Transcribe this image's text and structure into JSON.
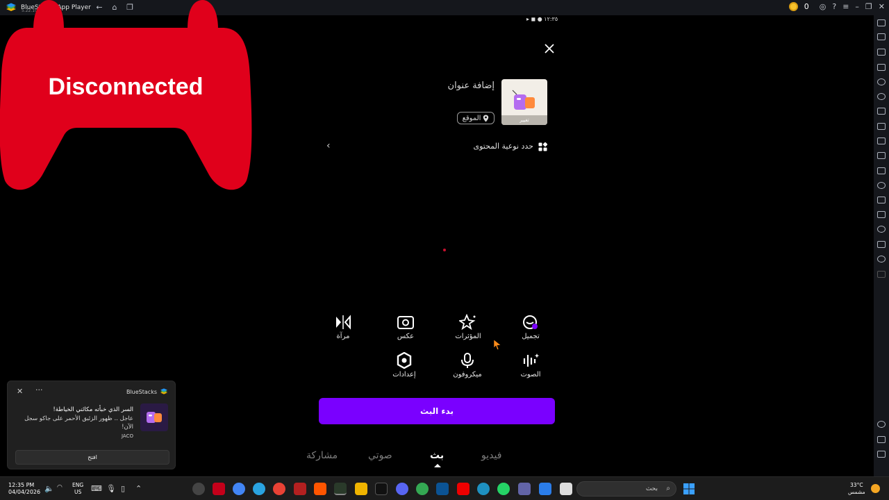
{
  "window": {
    "title": "BlueStacks App Player",
    "version": "5.22.100.1000",
    "coins": "0"
  },
  "android": {
    "status_time": "١٢:٣٥"
  },
  "overlay": {
    "disconnected_label": "Disconnected",
    "gamepad_color": "#e0001b"
  },
  "live_setup": {
    "add_title": "إضافة عنوان",
    "thumbnail_caption": "تغيير",
    "location_label": "الموقع",
    "content_type_label": "حدد نوعية المحتوى",
    "tools": [
      {
        "label": "تجميل",
        "icon": "beauty-icon"
      },
      {
        "label": "المؤثرات",
        "icon": "effects-icon"
      },
      {
        "label": "عكس",
        "icon": "flip-camera-icon"
      },
      {
        "label": "مرآة",
        "icon": "mirror-icon"
      },
      {
        "label": "الصوت",
        "icon": "voice-icon"
      },
      {
        "label": "ميكروفون",
        "icon": "microphone-icon"
      },
      {
        "label": "إعدادات",
        "icon": "settings-icon"
      }
    ],
    "start_button": "بدء البث",
    "accent_color": "#7a00ff"
  },
  "mode_tabs": [
    {
      "label": "فيديو",
      "active": false
    },
    {
      "label": "بث",
      "active": true
    },
    {
      "label": "صوتي",
      "active": false
    },
    {
      "label": "مشاركة",
      "active": false
    }
  ],
  "notification": {
    "app_name": "BlueStacks",
    "title": "السر الذي خبأته مكائني الخياطة!",
    "body": "عاجل .. ظهور الزئبق الأحمر على جاكو سجل الآن!",
    "source": "JACO",
    "action_button": "افتح"
  },
  "taskbar": {
    "time": "12:35 PM",
    "date": "04/04/2026",
    "lang_top": "ENG",
    "lang_bottom": "US",
    "search_placeholder": "بحث",
    "weather_temp": "33°C",
    "weather_desc": "مشمس"
  }
}
